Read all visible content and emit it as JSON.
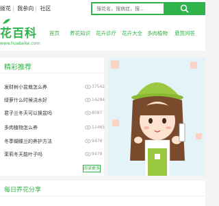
{
  "topbar": {
    "links": [
      "拨花",
      "我参向",
      "社区"
    ],
    "separator": "|",
    "search_placeholder": "搜花名，搜病症，搜..."
  },
  "header": {
    "logo_text": "花百科",
    "logo_url": "www.huabaike.com",
    "nav": [
      "首页",
      "养花知识",
      "花卉诊疗",
      "花卉大全",
      "多肉植物",
      "悬赏问答"
    ]
  },
  "featured": {
    "title": "精彩推荐",
    "items": [
      {
        "text": "发财树小盆栽怎么养",
        "count": "37542"
      },
      {
        "text": "绿萝什么时候浇水好",
        "count": "14284"
      },
      {
        "text": "君子兰冬天可以换盆吗",
        "count": "8087"
      },
      {
        "text": "多肉植物怎么养",
        "count": "12465"
      },
      {
        "text": "冬季蝴蝶兰的养护方法",
        "count": "9476"
      },
      {
        "text": "茉莉冬天能叶子吗",
        "count": "9478"
      }
    ],
    "more_label": "阅读更多"
  },
  "daily": {
    "title": "每日养花分享"
  },
  "colors": {
    "accent": "#2fb34a",
    "banner_bg": "#e3f3f7"
  },
  "icons": {
    "search": "search-icon",
    "views": "eye-icon"
  }
}
